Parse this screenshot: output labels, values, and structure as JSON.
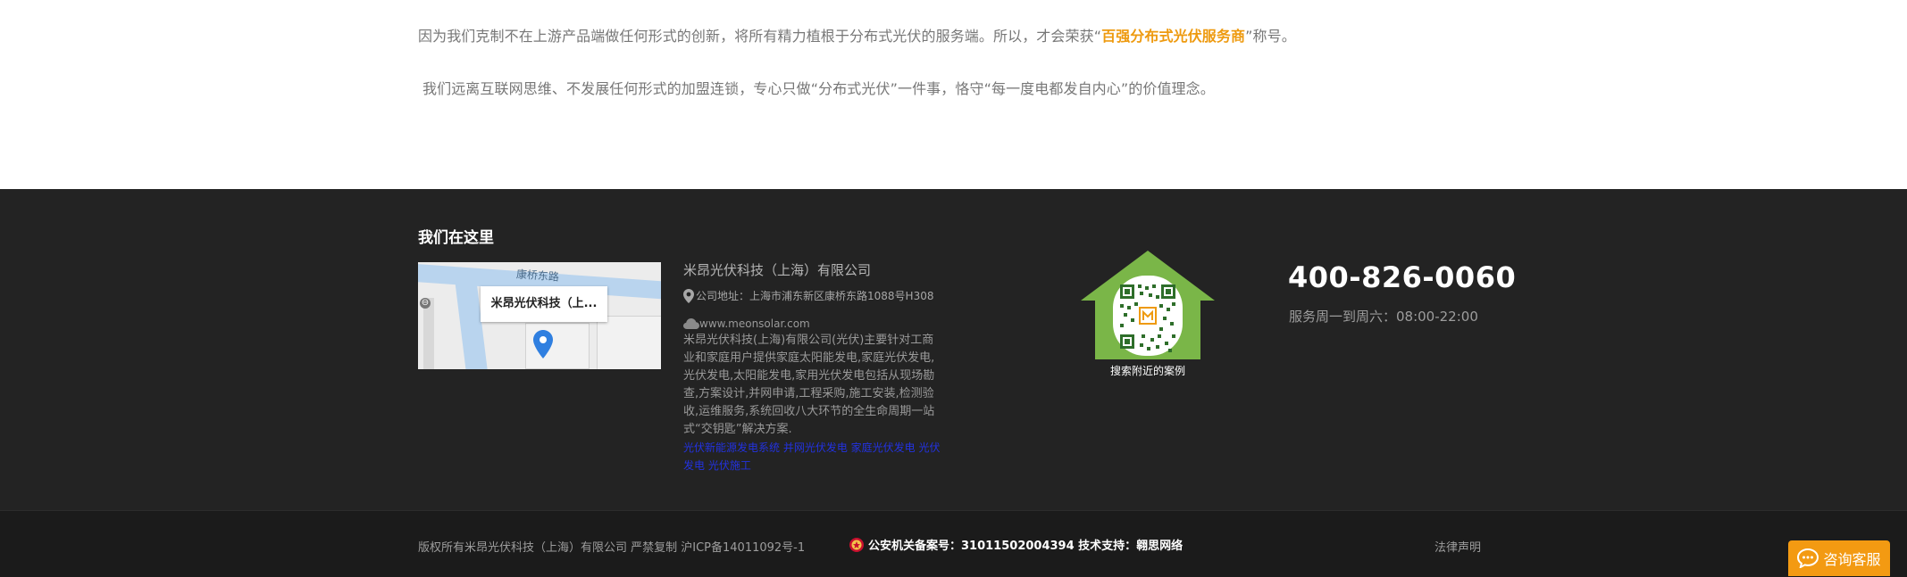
{
  "intro": {
    "p1_before": "因为我们克制不在上游产品端做任何形式的创新，将所有精力植根于分布式光伏的服务端。所以，才会荣获“",
    "p1_highlight": "百强分布式光伏服务商",
    "p1_after": "”称号。",
    "p2": "我们远离互联网思维、不发展任何形式的加盟连锁，专心只做“分布式光伏”一件事，恪守“每一度电都发自内心”的价值理念。"
  },
  "footer": {
    "title": "我们在这里",
    "map": {
      "road_label": "康桥东路",
      "marker_label": "米昂光伏科技（上...",
      "zoom_symbol": "⊖"
    },
    "company": {
      "name": "米昂光伏科技（上海）有限公司",
      "address": "公司地址：上海市浦东新区康桥东路1088号H308",
      "website": "www.meonsolar.com",
      "description": "米昂光伏科技(上海)有限公司(光伏)主要针对工商业和家庭用户提供家庭太阳能发电,家庭光伏发电,光伏发电,太阳能发电,家用光伏发电包括从现场勘查,方案设计,并网申请,工程采购,施工安装,检测验收,运维服务,系统回收八大环节的全生命周期一站式“交钥匙”解决方案.",
      "links": "光伏新能源发电系统 并网光伏发电 家庭光伏发电 光伏发电 光伏施工"
    },
    "qr_caption": "搜索附近的案例",
    "phone": "400-826-0060",
    "hours": "服务周一到周六：08:00-22:00",
    "colors": {
      "background": "#232323",
      "accent_green": "#7ab648",
      "accent_orange": "#ee9a0f"
    }
  },
  "bottom": {
    "copyright": "版权所有米昂光伏科技（上海）有限公司 严禁复制 沪ICP备14011092号-1",
    "police": "公安机关备案号：31011502004394 技术支持：翱思网络",
    "legal": "法律声明"
  },
  "chat": {
    "label": "咨询客服",
    "icon": "chat-bubble-icon"
  }
}
